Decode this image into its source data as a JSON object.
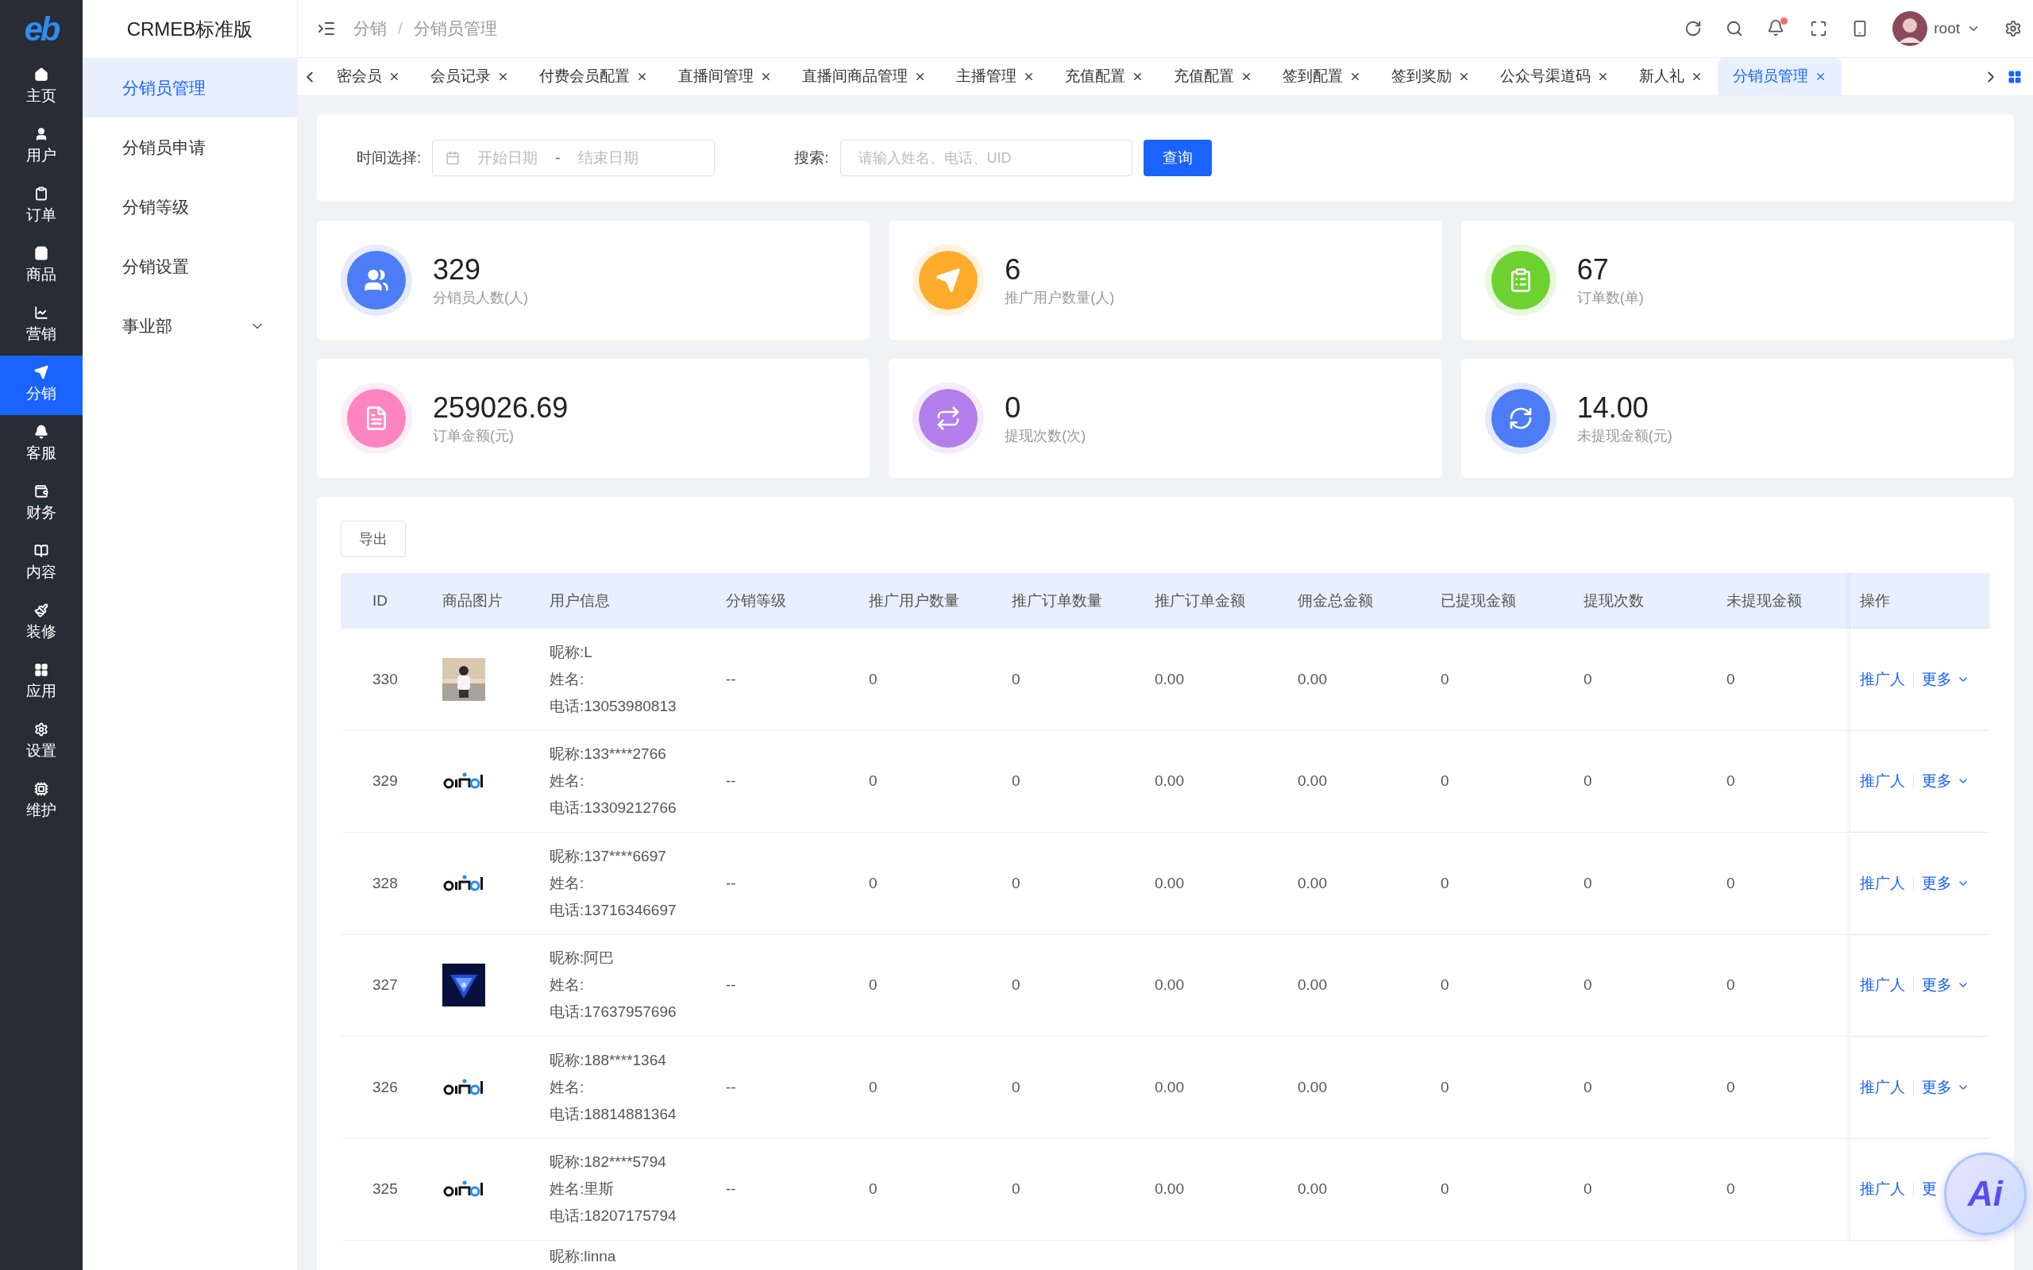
{
  "sidebar": {
    "logo": "eb",
    "items": [
      {
        "label": "主页",
        "selected": false
      },
      {
        "label": "用户",
        "selected": false
      },
      {
        "label": "订单",
        "selected": false
      },
      {
        "label": "商品",
        "selected": false
      },
      {
        "label": "营销",
        "selected": false
      },
      {
        "label": "分销",
        "selected": true
      },
      {
        "label": "客服",
        "selected": false
      },
      {
        "label": "财务",
        "selected": false
      },
      {
        "label": "内容",
        "selected": false
      },
      {
        "label": "装修",
        "selected": false
      },
      {
        "label": "应用",
        "selected": false
      },
      {
        "label": "设置",
        "selected": false
      },
      {
        "label": "维护",
        "selected": false
      }
    ]
  },
  "submenu": {
    "title": "CRMEB标准版",
    "items": [
      {
        "label": "分销员管理",
        "kind": "link",
        "selected": true
      },
      {
        "label": "分销员申请",
        "kind": "link",
        "selected": false
      },
      {
        "label": "分销等级",
        "kind": "link",
        "selected": false
      },
      {
        "label": "分销设置",
        "kind": "link",
        "selected": false
      },
      {
        "label": "事业部",
        "kind": "group",
        "selected": false
      }
    ]
  },
  "header": {
    "breadcrumb": [
      "分销",
      "分销员管理"
    ],
    "breadcrumb_separator": "/",
    "has_notification": true,
    "user": "root"
  },
  "tabs": [
    {
      "label": "密会员",
      "selected": false
    },
    {
      "label": "会员记录",
      "selected": false
    },
    {
      "label": "付费会员配置",
      "selected": false
    },
    {
      "label": "直播间管理",
      "selected": false
    },
    {
      "label": "直播间商品管理",
      "selected": false
    },
    {
      "label": "主播管理",
      "selected": false
    },
    {
      "label": "充值配置",
      "selected": false
    },
    {
      "label": "充值配置",
      "selected": false
    },
    {
      "label": "签到配置",
      "selected": false
    },
    {
      "label": "签到奖励",
      "selected": false
    },
    {
      "label": "公众号渠道码",
      "selected": false
    },
    {
      "label": "新人礼",
      "selected": false
    },
    {
      "label": "分销员管理",
      "selected": true
    }
  ],
  "filter": {
    "date_label": "时间选择:",
    "start_placeholder": "开始日期",
    "range_separator": "-",
    "end_placeholder": "结束日期",
    "search_label": "搜索:",
    "search_placeholder": "请输入姓名、电话、UID",
    "query_button": "查询"
  },
  "stats": [
    {
      "value": "329",
      "label": "分销员人数(人)",
      "color": "#4c7cf6"
    },
    {
      "value": "6",
      "label": "推广用户数量(人)",
      "color": "#ffab2b"
    },
    {
      "value": "67",
      "label": "订单数(单)",
      "color": "#6dd230"
    },
    {
      "value": "259026.69",
      "label": "订单金额(元)",
      "color": "#ff85c0"
    },
    {
      "value": "0",
      "label": "提现次数(次)",
      "color": "#b37feb"
    },
    {
      "value": "14.00",
      "label": "未提现金额(元)",
      "color": "#4c7cf6"
    }
  ],
  "table": {
    "export_button": "导出",
    "columns": [
      "ID",
      "商品图片",
      "用户信息",
      "分销等级",
      "推广用户数量",
      "推广订单数量",
      "推广订单金额",
      "佣金总金额",
      "已提现金额",
      "提现次数",
      "未提现金额",
      "操作"
    ],
    "rows": [
      {
        "id": "330",
        "user_info": [
          "昵称:L",
          "姓名:",
          "电话:13053980813"
        ],
        "level": "--",
        "promoted_users": "0",
        "promoted_orders": "0",
        "order_amount": "0.00",
        "commission_total": "0.00",
        "withdrawn": "0",
        "withdraw_count": "0",
        "not_withdrawn": "0",
        "actions": [
          {
            "label": "推广人",
            "caret": false
          },
          {
            "label": "更多",
            "caret": true
          }
        ]
      },
      {
        "id": "329",
        "user_info": [
          "昵称:133****2766",
          "姓名:",
          "电话:13309212766"
        ],
        "level": "--",
        "promoted_users": "0",
        "promoted_orders": "0",
        "order_amount": "0.00",
        "commission_total": "0.00",
        "withdrawn": "0",
        "withdraw_count": "0",
        "not_withdrawn": "0",
        "actions": [
          {
            "label": "推广人",
            "caret": false
          },
          {
            "label": "更多",
            "caret": true
          }
        ]
      },
      {
        "id": "328",
        "user_info": [
          "昵称:137****6697",
          "姓名:",
          "电话:13716346697"
        ],
        "level": "--",
        "promoted_users": "0",
        "promoted_orders": "0",
        "order_amount": "0.00",
        "commission_total": "0.00",
        "withdrawn": "0",
        "withdraw_count": "0",
        "not_withdrawn": "0",
        "actions": [
          {
            "label": "推广人",
            "caret": false
          },
          {
            "label": "更多",
            "caret": true
          }
        ]
      },
      {
        "id": "327",
        "user_info": [
          "昵称:阿巴",
          "姓名:",
          "电话:17637957696"
        ],
        "level": "--",
        "promoted_users": "0",
        "promoted_orders": "0",
        "order_amount": "0.00",
        "commission_total": "0.00",
        "withdrawn": "0",
        "withdraw_count": "0",
        "not_withdrawn": "0",
        "actions": [
          {
            "label": "推广人",
            "caret": false
          },
          {
            "label": "更多",
            "caret": true
          }
        ]
      },
      {
        "id": "326",
        "user_info": [
          "昵称:188****1364",
          "姓名:",
          "电话:18814881364"
        ],
        "level": "--",
        "promoted_users": "0",
        "promoted_orders": "0",
        "order_amount": "0.00",
        "commission_total": "0.00",
        "withdrawn": "0",
        "withdraw_count": "0",
        "not_withdrawn": "0",
        "actions": [
          {
            "label": "推广人",
            "caret": false
          },
          {
            "label": "更多",
            "caret": true
          }
        ]
      },
      {
        "id": "325",
        "user_info": [
          "昵称:182****5794",
          "姓名:里斯",
          "电话:18207175794"
        ],
        "level": "--",
        "promoted_users": "0",
        "promoted_orders": "0",
        "order_amount": "0.00",
        "commission_total": "0.00",
        "withdrawn": "0",
        "withdraw_count": "0",
        "not_withdrawn": "0",
        "actions": [
          {
            "label": "推广人",
            "caret": false
          },
          {
            "label": "更",
            "caret": false
          }
        ]
      },
      {
        "user_info": [
          "昵称:linna"
        ]
      }
    ]
  },
  "ai_button": "Ai"
}
